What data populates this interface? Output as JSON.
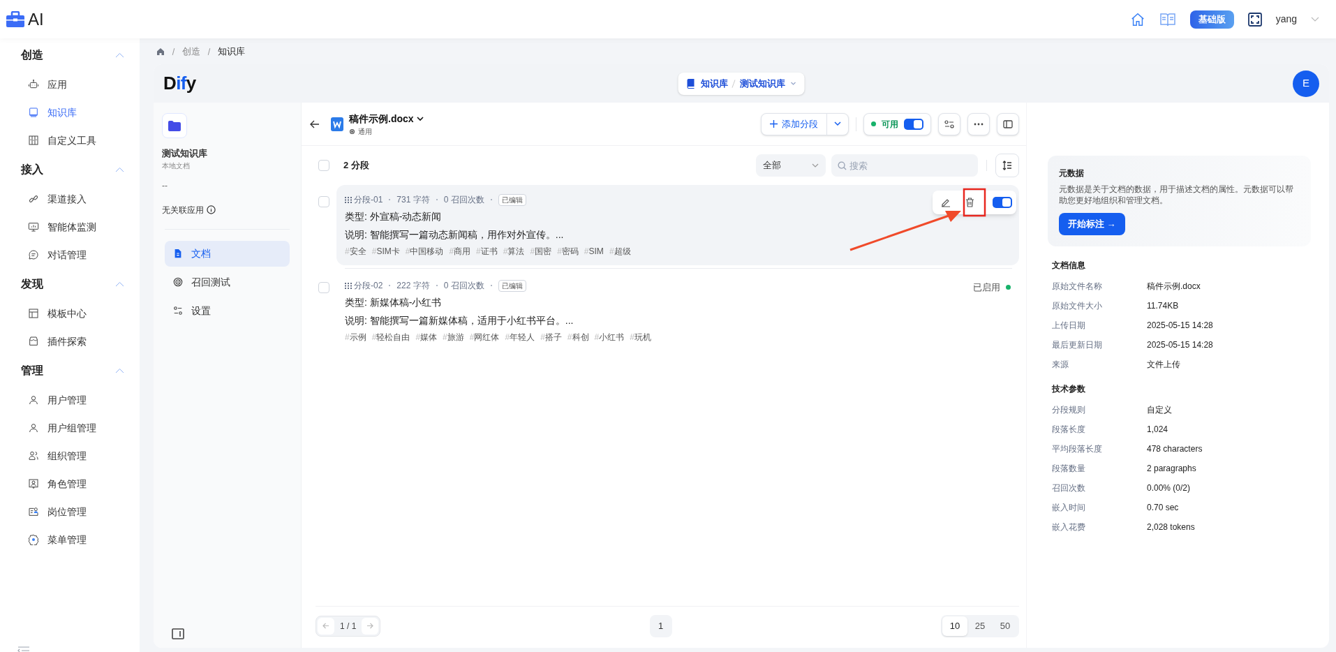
{
  "app": {
    "title": "AI",
    "plan": "基础版",
    "user": "yang"
  },
  "sidebar": [
    {
      "heading": "创造",
      "expanded": true,
      "items": [
        {
          "label": "应用",
          "selected": false
        },
        {
          "label": "知识库",
          "selected": true
        },
        {
          "label": "自定义工具",
          "selected": false
        }
      ]
    },
    {
      "heading": "接入",
      "expanded": true,
      "items": [
        {
          "label": "渠道接入",
          "selected": false
        },
        {
          "label": "智能体监测",
          "selected": false
        },
        {
          "label": "对话管理",
          "selected": false
        }
      ]
    },
    {
      "heading": "发现",
      "expanded": true,
      "items": [
        {
          "label": "模板中心",
          "selected": false
        },
        {
          "label": "插件探索",
          "selected": false
        }
      ]
    },
    {
      "heading": "管理",
      "expanded": true,
      "items": [
        {
          "label": "用户管理",
          "selected": false
        },
        {
          "label": "用户组管理",
          "selected": false
        },
        {
          "label": "组织管理",
          "selected": false
        },
        {
          "label": "角色管理",
          "selected": false
        },
        {
          "label": "岗位管理",
          "selected": false
        },
        {
          "label": "菜单管理",
          "selected": false
        }
      ]
    }
  ],
  "breadcrumb": [
    "创造",
    "知识库"
  ],
  "logo": "Dify",
  "switcher": {
    "section": "知识库",
    "dataset": "测试知识库"
  },
  "avatar": "E",
  "dataset": {
    "name": "测试知识库",
    "source": "本地文档",
    "description": "--",
    "apps": "无关联应用",
    "nav": [
      {
        "label": "文档",
        "selected": true
      },
      {
        "label": "召回测试",
        "selected": false
      },
      {
        "label": "设置",
        "selected": false
      }
    ]
  },
  "document": {
    "name": "稿件示例.docx",
    "mode": "通用",
    "add_button": "添加分段",
    "status": "可用",
    "enabled": true
  },
  "list": {
    "checked": false,
    "count": "2 分段",
    "filter": "全部",
    "search_placeholder": "搜索"
  },
  "segments": [
    {
      "checked": false,
      "id": "分段-01",
      "chars": "731 字符",
      "hits": "0 召回次数",
      "badge": "已编辑",
      "type": "类型: 外宣稿-动态新闻",
      "desc": "说明: 智能撰写一篇动态新闻稿，用作对外宣传。...",
      "tags": [
        "#安全",
        "#SIM卡",
        "#中国移动",
        "#商用",
        "#证书",
        "#算法",
        "#国密",
        "#密码",
        "#SIM",
        "#超级"
      ],
      "hovered": true,
      "enabled": true
    },
    {
      "checked": false,
      "id": "分段-02",
      "chars": "222 字符",
      "hits": "0 召回次数",
      "badge": "已编辑",
      "type": "类型: 新媒体稿-小红书",
      "desc": "说明: 智能撰写一篇新媒体稿，适用于小红书平台。...",
      "tags": [
        "#示例",
        "#轻松自由",
        "#媒体",
        "#旅游",
        "#网红体",
        "#年轻人",
        "#搭子",
        "#科创",
        "#小红书",
        "#玩机"
      ],
      "hovered": false,
      "enabled": true,
      "status": "已启用"
    }
  ],
  "pagination": {
    "page": "1 / 1",
    "current": "1",
    "sizes": [
      {
        "label": "10",
        "selected": true
      },
      {
        "label": "25",
        "selected": false
      },
      {
        "label": "50",
        "selected": false
      }
    ]
  },
  "metadata": {
    "title": "元数据",
    "description": "元数据是关于文档的数据，用于描述文档的属性。元数据可以帮助您更好地组织和管理文档。",
    "button": "开始标注 →"
  },
  "info_sections": [
    {
      "title": "文档信息",
      "rows": [
        [
          "原始文件名称",
          "稿件示例.docx"
        ],
        [
          "原始文件大小",
          "11.74KB"
        ],
        [
          "上传日期",
          "2025-05-15 14:28"
        ],
        [
          "最后更新日期",
          "2025-05-15 14:28"
        ],
        [
          "来源",
          "文件上传"
        ]
      ]
    },
    {
      "title": "技术参数",
      "rows": [
        [
          "分段规则",
          "自定义"
        ],
        [
          "段落长度",
          "1,024"
        ],
        [
          "平均段落长度",
          "478 characters"
        ],
        [
          "段落数量",
          "2 paragraphs"
        ],
        [
          "召回次数",
          "0.00% (0/2)"
        ],
        [
          "嵌入时间",
          "0.70 sec"
        ],
        [
          "嵌入花费",
          "2,028 tokens"
        ]
      ]
    }
  ]
}
